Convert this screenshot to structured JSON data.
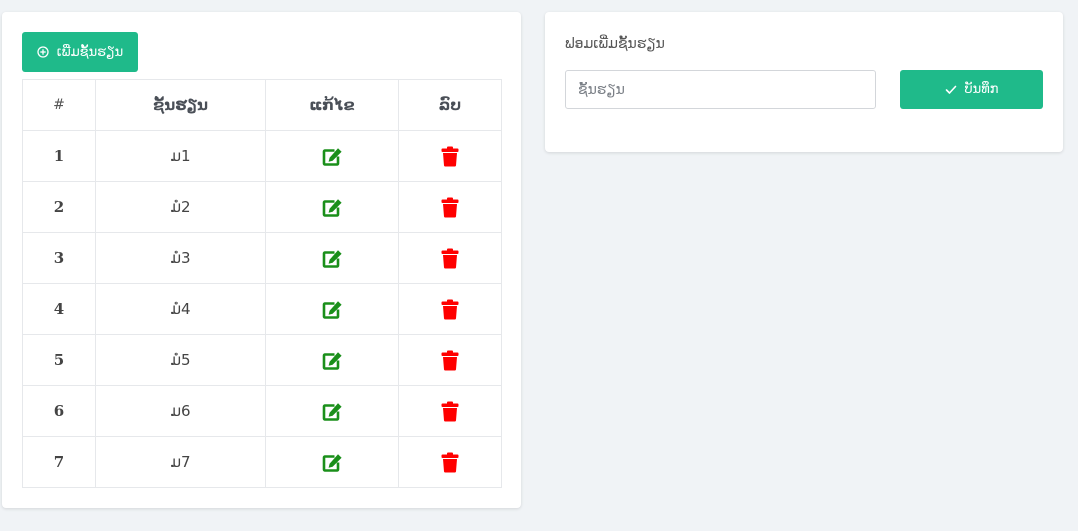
{
  "colors": {
    "accent": "#1fba8a",
    "edit_icon": "#1a8f1a",
    "delete_icon": "#ff0000",
    "background": "#f0f3f6"
  },
  "list_panel": {
    "add_button_label": "ເພີ່ມຊັ້ນຮຽນ",
    "add_button_icon": "plus-circle-icon",
    "table": {
      "headers": [
        "#",
        "ຊັ້ນຮຽນ",
        "ແກ້ໄຂ",
        "ລົບ"
      ],
      "rows": [
        {
          "num": "1",
          "name": "ມ1"
        },
        {
          "num": "2",
          "name": "ມໍ2"
        },
        {
          "num": "3",
          "name": "ມໍ3"
        },
        {
          "num": "4",
          "name": "ມໍ4"
        },
        {
          "num": "5",
          "name": "ມໍ5"
        },
        {
          "num": "6",
          "name": "ມ6"
        },
        {
          "num": "7",
          "name": "ມ7"
        }
      ],
      "edit_icon": "edit-icon",
      "delete_icon": "trash-icon"
    }
  },
  "form_panel": {
    "title": "ຟອມເພີ່ມຊັ້ນຮຽນ",
    "input_placeholder": "ຊັ້ນຮຽນ",
    "input_value": "",
    "save_button_label": "ບັນທຶກ",
    "save_button_icon": "check-icon"
  }
}
